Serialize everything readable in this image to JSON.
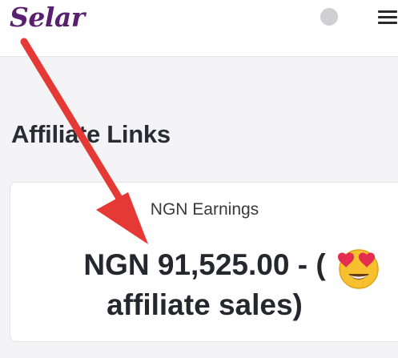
{
  "header": {
    "logo_text": "Selar",
    "avatar": "avatar",
    "menu_icon": "menu-icon"
  },
  "page": {
    "title": "Affiliate Links"
  },
  "earnings_card": {
    "label": "NGN Earnings",
    "value": "NGN 91,525.00 - (",
    "value_suffix": "affiliate sales)"
  },
  "overlay": {
    "arrow": "red-arrow-icon",
    "arrow_color": "#e53935",
    "emoji": "heart-eyes-emoji-icon"
  },
  "colors": {
    "brand": "#5a1f6e",
    "text": "#26262e"
  }
}
